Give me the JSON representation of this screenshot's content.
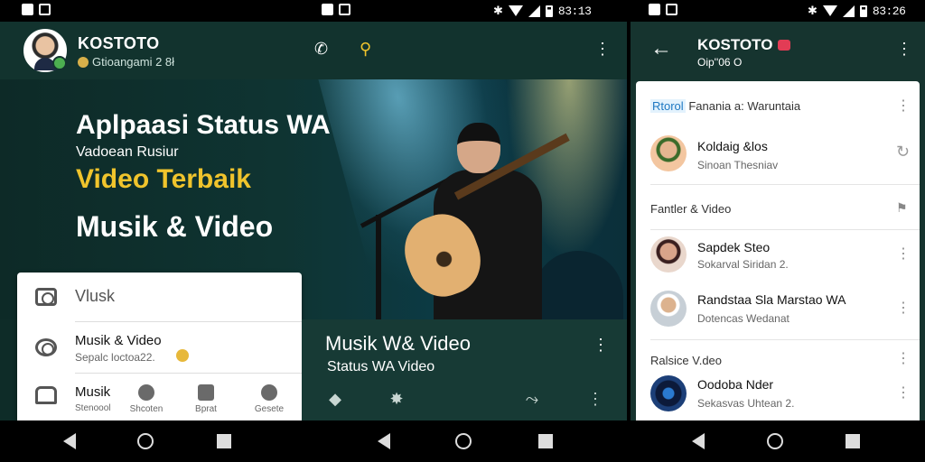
{
  "statusbar": {
    "left_time": "83:13",
    "right_time": "83:26"
  },
  "main_screen": {
    "app_title": "KOSTOTO",
    "app_subtitle": "Gtioangami 2 8ł",
    "hero": {
      "line1": "Aplpaasi Status WA",
      "line2": "Vadoean Rusiur",
      "line3": "Video Terbaik",
      "line4": "Musik & Video"
    },
    "card": {
      "header": "Vlusk",
      "item1_name": "Musik & Video",
      "item1_sub": "Sepalc loctoa22.",
      "item2_name": "Musik",
      "item2_sub": "Stenoool",
      "actions": [
        "Shcoten",
        "Bprat",
        "Gesete"
      ]
    },
    "footer": {
      "title": "Musik W& Video",
      "subtitle": "Status WA Video"
    }
  },
  "chat_screen": {
    "title": "KOSTOTO",
    "subtitle": "Oip''06 O",
    "section1_tag": "Rtorol",
    "section1_label": "Fanania a: Waruntaia",
    "items": [
      {
        "name": "Koldaig &los",
        "sub": "Sinoan Thesniav"
      },
      {
        "name": "Sapdek Steo",
        "sub": "Sokarval Siridan 2."
      },
      {
        "name": "Randstaa Sla Marstao WA",
        "sub": "Dotencas Wedanat"
      },
      {
        "name": "Oodoba Nder",
        "sub": "Sekasvas Uhtean 2."
      }
    ],
    "section2_label": "Fantler & Video",
    "section3_label": "Ralsice V.deo"
  },
  "colors": {
    "accent_yellow": "#f0c42c",
    "header_green": "#12332e",
    "online_green": "#4caf50"
  }
}
